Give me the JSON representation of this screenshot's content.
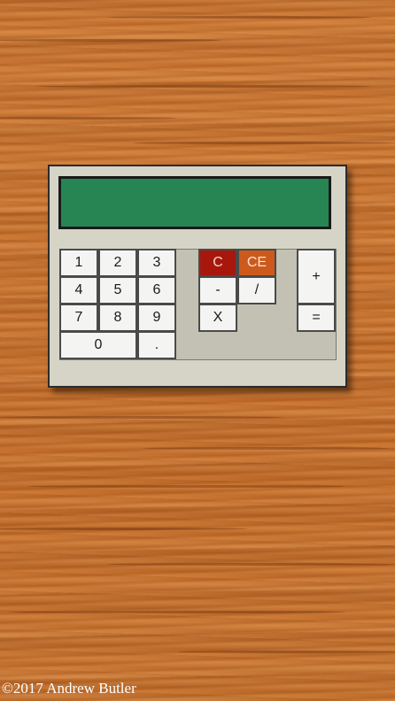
{
  "colors": {
    "background_wood": "#cc7530",
    "calculator_body": "#d6d4c6",
    "display": "#268552",
    "keypad_panel": "#c2c1b4",
    "key": "#f4f4f2",
    "clear_key": "#a8170c",
    "clear_entry_key": "#cc5a1c"
  },
  "display": {
    "value": ""
  },
  "keys": {
    "one": "1",
    "two": "2",
    "three": "3",
    "four": "4",
    "five": "5",
    "six": "6",
    "seven": "7",
    "eight": "8",
    "nine": "9",
    "zero": "0",
    "decimal": ".",
    "clear": "C",
    "clear_entry": "CE",
    "minus": "-",
    "divide": "/",
    "multiply": "X",
    "plus": "+",
    "equals": "="
  },
  "footer": {
    "copyright": "©2017 Andrew Butler"
  }
}
